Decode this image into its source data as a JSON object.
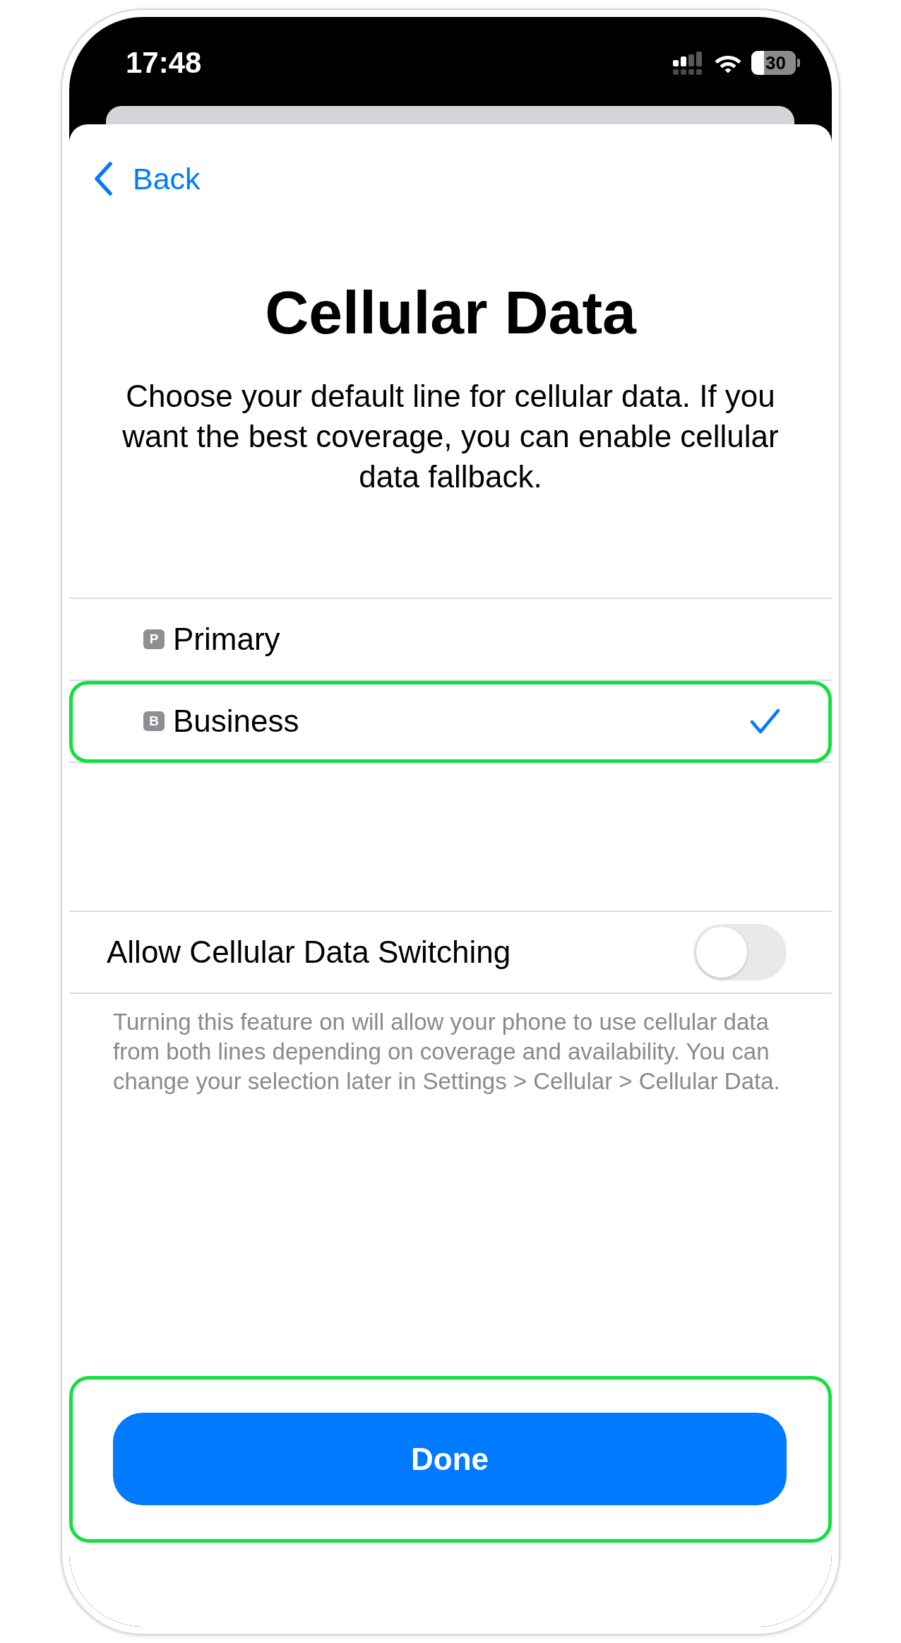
{
  "status_bar": {
    "time": "17:48",
    "battery": "30"
  },
  "nav": {
    "back": "Back"
  },
  "title": "Cellular Data",
  "description": "Choose your default line for cellular data. If you want the best coverage, you can enable cellular data fallback.",
  "lines": [
    {
      "badge": "P",
      "name": "Primary",
      "selected": false,
      "highlighted": false
    },
    {
      "badge": "B",
      "name": "Business",
      "selected": true,
      "highlighted": true
    }
  ],
  "switching": {
    "label": "Allow Cellular Data Switching",
    "on": false,
    "footer": "Turning this feature on will allow your phone to use cellular data from both lines depending on coverage and availability. You can change your selection later in Settings > Cellular > Cellular Data."
  },
  "done": {
    "label": "Done",
    "highlighted": true
  }
}
